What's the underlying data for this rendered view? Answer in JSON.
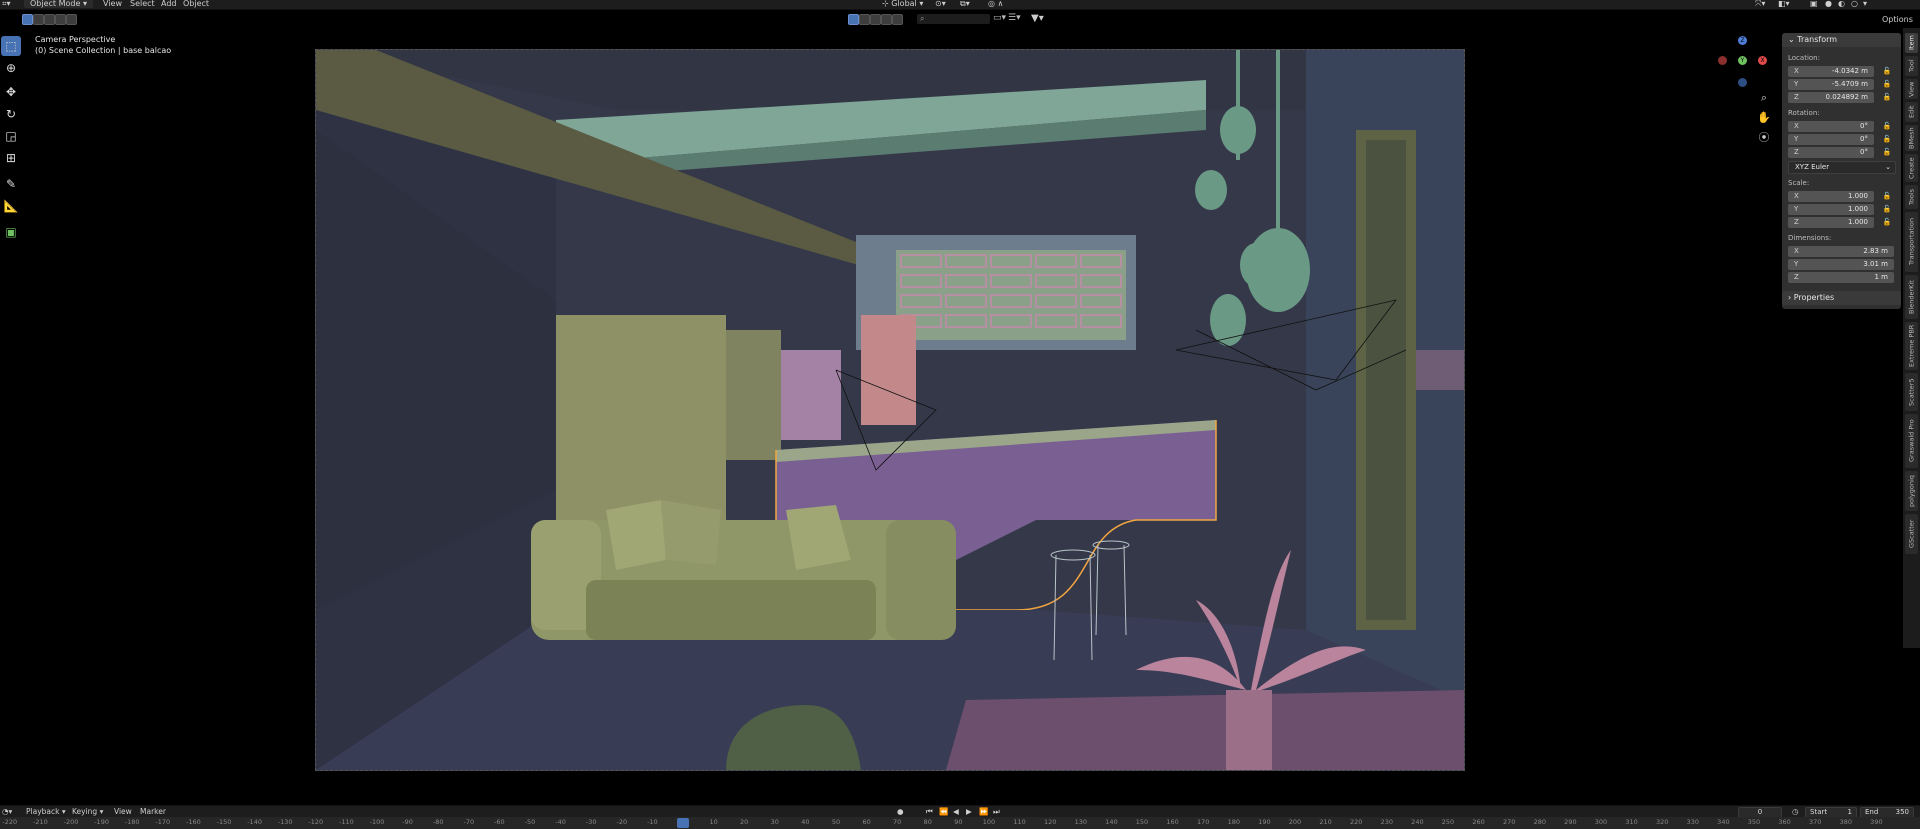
{
  "header": {
    "editor_type_icon": "editor-type-icon",
    "mode": "Object Mode",
    "menus": [
      "View",
      "Select",
      "Add",
      "Object"
    ],
    "orientation": "Global",
    "options": "Options"
  },
  "viewport": {
    "view_name": "Camera Perspective",
    "collection_info": "(0) Scene Collection | base balcao"
  },
  "gizmo": {
    "x": "X",
    "y": "Y",
    "z": "Z"
  },
  "npanel": {
    "title": "Transform",
    "location_label": "Location:",
    "location": [
      {
        "axis": "X",
        "value": "-4.0342 m"
      },
      {
        "axis": "Y",
        "value": "-5.4709 m"
      },
      {
        "axis": "Z",
        "value": "0.024892 m"
      }
    ],
    "rotation_label": "Rotation:",
    "rotation": [
      {
        "axis": "X",
        "value": "0°"
      },
      {
        "axis": "Y",
        "value": "0°"
      },
      {
        "axis": "Z",
        "value": "0°"
      }
    ],
    "rotation_mode": "XYZ Euler",
    "scale_label": "Scale:",
    "scale": [
      {
        "axis": "X",
        "value": "1.000"
      },
      {
        "axis": "Y",
        "value": "1.000"
      },
      {
        "axis": "Z",
        "value": "1.000"
      }
    ],
    "dimensions_label": "Dimensions:",
    "dimensions": [
      {
        "axis": "X",
        "value": "2.83 m"
      },
      {
        "axis": "Y",
        "value": "3.01 m"
      },
      {
        "axis": "Z",
        "value": "1 m"
      }
    ],
    "properties_label": "Properties"
  },
  "side_tabs": [
    "Item",
    "Tool",
    "View",
    "Edit",
    "BMesh",
    "Create",
    "Tools",
    "Transportation",
    "BlenderKit",
    "Extreme PBR",
    "Scatter5",
    "Graswald Pro",
    "polygoniq",
    "GScatter"
  ],
  "timeline": {
    "playback": "Playback",
    "keying": "Keying",
    "view": "View",
    "marker": "Marker",
    "current_frame": "0",
    "start_label": "Start",
    "start": "1",
    "end_label": "End",
    "end": "350",
    "ruler_ticks": [
      "-220",
      "-210",
      "-200",
      "-190",
      "-180",
      "-170",
      "-160",
      "-150",
      "-140",
      "-130",
      "-120",
      "-110",
      "-100",
      "-90",
      "-80",
      "-70",
      "-60",
      "-50",
      "-40",
      "-30",
      "-20",
      "-10",
      "0",
      "10",
      "20",
      "30",
      "40",
      "50",
      "60",
      "70",
      "80",
      "90",
      "100",
      "110",
      "120",
      "130",
      "140",
      "150",
      "160",
      "170",
      "180",
      "190",
      "200",
      "210",
      "220",
      "230",
      "240",
      "250",
      "260",
      "270",
      "280",
      "290",
      "300",
      "310",
      "320",
      "330",
      "340",
      "350",
      "360",
      "370",
      "380",
      "390"
    ]
  },
  "colors": {
    "accent": "#4772b3",
    "selection_outline": "#f2a640",
    "panel_bg": "#303030"
  }
}
